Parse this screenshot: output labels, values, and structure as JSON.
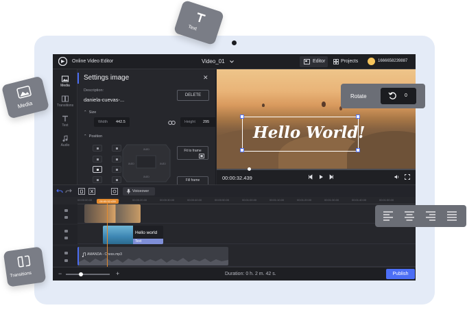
{
  "app": {
    "title": "Online Video Editor",
    "project_name": "Video_01",
    "user_id": "1666658239887"
  },
  "header": {
    "tabs": [
      {
        "label": "Editor",
        "active": true
      },
      {
        "label": "Projects",
        "active": false
      }
    ]
  },
  "left_nav": [
    {
      "label": "Media",
      "icon": "image-icon",
      "active": true
    },
    {
      "label": "Transitions",
      "icon": "transitions-icon",
      "active": false
    },
    {
      "label": "Text",
      "icon": "text-icon",
      "active": false
    },
    {
      "label": "Audio",
      "icon": "music-note-icon",
      "active": false
    }
  ],
  "settings": {
    "title": "Settings image",
    "description_label": "Description:",
    "description_value": "daniela-cuevas-...",
    "delete_label": "DELETE",
    "size_label": "Size",
    "width_label": "Width",
    "width_value": "442.5",
    "height_label": "Height",
    "height_value": "295",
    "position_label": "Position",
    "auto_label": "auto",
    "fit_label": "Fit to frame",
    "fill_label": "Fill frame"
  },
  "preview": {
    "overlay_text": "Hello World!",
    "time": "00:00:32.439"
  },
  "timeline": {
    "voiceover_label": "Voiceover",
    "playhead_time": "00:00:32:439",
    "ruler_ticks": [
      "00:00:00.00",
      "00:00:10.00",
      "00:00:20.00",
      "00:00:30.00",
      "00:00:40.00",
      "00:00:50.00",
      "00:01:00.00",
      "00:01:10.00",
      "00:01:20.00",
      "00:01:30.00",
      "00:01:40.00",
      "00:01:50.00"
    ],
    "image_clip_label": "Hello world",
    "text_tag": "Text",
    "audio_clip_label": "AMANDA - Chess.mp3"
  },
  "bottom": {
    "duration": "Duration: 0 h. 2 m. 42 s.",
    "publish_label": "Publish",
    "zoom_minus": "−",
    "zoom_plus": "+"
  },
  "floating": {
    "text_card": "Text",
    "media_card": "Media",
    "transitions_card": "Transitions",
    "rotate_label": "Rotate",
    "rotate_value": "0",
    "align_icons": [
      "align-left-icon",
      "align-center-icon",
      "align-right-icon",
      "align-justify-icon"
    ]
  },
  "colors": {
    "accent": "#4c6ef5",
    "playhead": "#e58b2e",
    "tablet_bg": "#e4ebf7",
    "editor_bg": "#26272c"
  }
}
